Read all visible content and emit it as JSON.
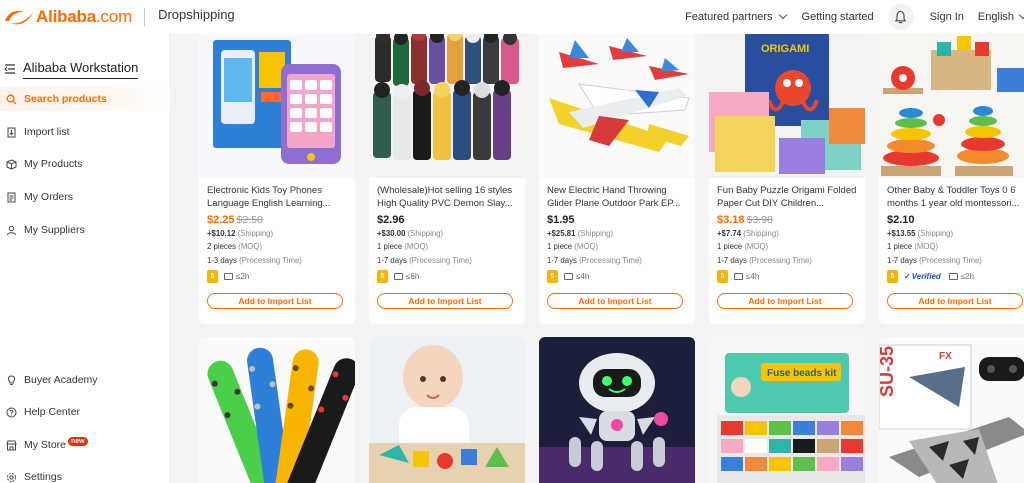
{
  "header": {
    "logo_text": "Alibaba",
    "logo_dotcom": ".com",
    "subtitle": "Dropshipping",
    "featured_partners": "Featured partners",
    "getting_started": "Getting started",
    "sign_in": "Sign In",
    "language": "English",
    "brand_color": "#ff6a00"
  },
  "sidebar": {
    "title": "Alibaba Workstation",
    "items": [
      {
        "label": "Search products",
        "icon": "search-icon",
        "active": true
      },
      {
        "label": "Import list",
        "icon": "import-icon"
      },
      {
        "label": "My Products",
        "icon": "box-icon"
      },
      {
        "label": "My Orders",
        "icon": "orders-icon"
      },
      {
        "label": "My Suppliers",
        "icon": "person-icon"
      }
    ],
    "bottom_items": [
      {
        "label": "Buyer Academy",
        "icon": "lightbulb-icon"
      },
      {
        "label": "Help Center",
        "icon": "help-icon"
      },
      {
        "label": "My Store",
        "icon": "store-icon",
        "badge": "new"
      },
      {
        "label": "Settings",
        "icon": "gear-icon"
      }
    ]
  },
  "products": [
    {
      "title": "Electronic Kids Toy Phones Language English Learning...",
      "price": "$2.25",
      "orig_price": "$2.50",
      "shipping": "+$10.12",
      "shipping_label": "(Shipping)",
      "moq": "2 pieces",
      "moq_label": "(MOQ)",
      "processing": "1-3 days",
      "processing_label": "(Processing Time)",
      "response": "≤2h",
      "button": "Add to Import List"
    },
    {
      "title": "(Wholesale)Hot selling 16 styles High Quality PVC Demon Slay...",
      "price": "$2.96",
      "orig_price": "",
      "shipping": "+$30.00",
      "shipping_label": "(Shipping)",
      "moq": "1 piece",
      "moq_label": "(MOQ)",
      "processing": "1-7 days",
      "processing_label": "(Processing Time)",
      "response": "≤6h",
      "button": "Add to Import List"
    },
    {
      "title": "New Electric Hand Throwing Glider Plane Outdoor Park EP...",
      "price": "$1.95",
      "orig_price": "",
      "shipping": "+$25.81",
      "shipping_label": "(Shipping)",
      "moq": "1 piece",
      "moq_label": "(MOQ)",
      "processing": "1-7 days",
      "processing_label": "(Processing Time)",
      "response": "≤4h",
      "button": "Add to Import List"
    },
    {
      "title": "Fun Baby Puzzle Origami Folded Paper Cut DIY Children...",
      "price": "$3.18",
      "orig_price": "$3.98",
      "shipping": "+$7.74",
      "shipping_label": "(Shipping)",
      "moq": "1 piece",
      "moq_label": "(MOQ)",
      "processing": "1-7 days",
      "processing_label": "(Processing Time)",
      "response": "≤4h",
      "button": "Add to Import List"
    },
    {
      "title": "Other Baby & Toddler Toys 0 6 months 1 year old montessori...",
      "price": "$2.10",
      "orig_price": "",
      "shipping": "+$13.55",
      "shipping_label": "(Shipping)",
      "moq": "1 piece",
      "moq_label": "(MOQ)",
      "processing": "1-7 days",
      "processing_label": "(Processing Time)",
      "verified": "Verified",
      "response": "≤2h",
      "button": "Add to Import List"
    }
  ],
  "origami_book_label": "ORIGAMI",
  "fuse_box_label": "Fuse beads kit",
  "jet_box_label": "SU-35",
  "jet_box_tag": "FX"
}
